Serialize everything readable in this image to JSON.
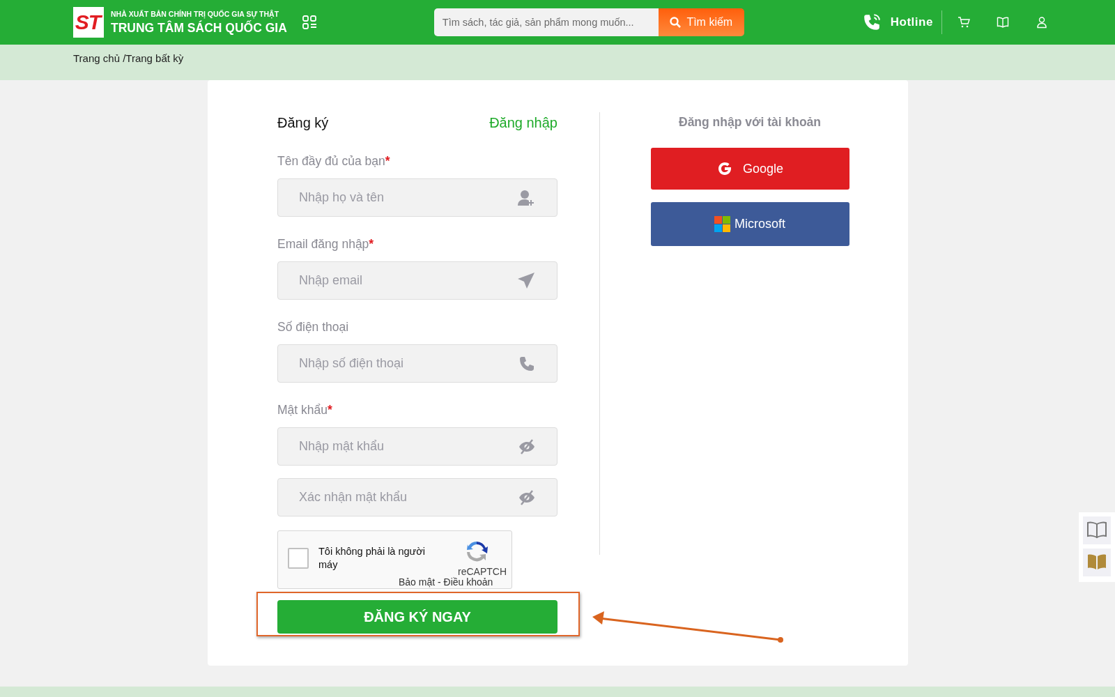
{
  "header": {
    "logo_mark": "ST",
    "publisher": "NHÀ XUẤT BẢN CHÍNH TRỊ QUỐC GIA SỰ THẬT",
    "site_name": "TRUNG TÂM SÁCH QUỐC GIA",
    "search": {
      "placeholder": "Tìm sách, tác giả, sản phẩm mong muốn..."
    },
    "search_button": "Tìm kiếm",
    "hotline": "Hotline"
  },
  "breadcrumb": "Trang chủ /Trang bất kỳ",
  "form": {
    "tabs": [
      {
        "label": "Đăng ký",
        "selected": true
      },
      {
        "label": "Đăng nhập",
        "selected": false
      }
    ],
    "fields": [
      {
        "label": "Tên đầy đủ của bạn",
        "required_mark": "*",
        "placeholder": "Nhập họ và tên",
        "kind": "user"
      },
      {
        "label": "Email đăng nhập",
        "required_mark": "*",
        "placeholder": "Nhập email",
        "kind": "send"
      },
      {
        "label": "Số điện thoại",
        "placeholder": "Nhập số điện thoại",
        "kind": "phone"
      },
      {
        "label": "Mật khẩu",
        "required_mark": "*",
        "placeholder": "Nhập mật khẩu",
        "kind": "password"
      },
      {
        "placeholder": "Xác nhận mật khẩu",
        "kind": "password"
      }
    ],
    "captcha": {
      "label": "Tôi không phải là người máy",
      "checked": false,
      "brand": "reCAPTCH",
      "links": "Bảo mật - Điều khoản"
    },
    "submit": "ĐĂNG KÝ NGAY"
  },
  "social": {
    "title": "Đăng nhập với tài khoản",
    "buttons": [
      {
        "kind": "google",
        "label": "Google"
      },
      {
        "kind": "microsoft",
        "label": "Microsoft"
      }
    ]
  }
}
